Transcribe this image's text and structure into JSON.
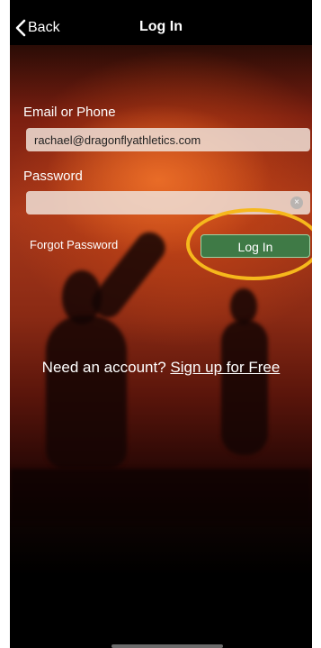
{
  "navbar": {
    "back_label": "Back",
    "title": "Log In"
  },
  "form": {
    "email_label": "Email or Phone",
    "email_value": "rachael@dragonflyathletics.com",
    "password_label": "Password",
    "password_value": "",
    "forgot_password": "Forgot Password",
    "login_button": "Log In"
  },
  "signup": {
    "prompt": "Need an account?",
    "link": "Sign up for Free"
  },
  "colors": {
    "login_button": "#3f7a46",
    "highlight_ring": "#f6b81c"
  }
}
